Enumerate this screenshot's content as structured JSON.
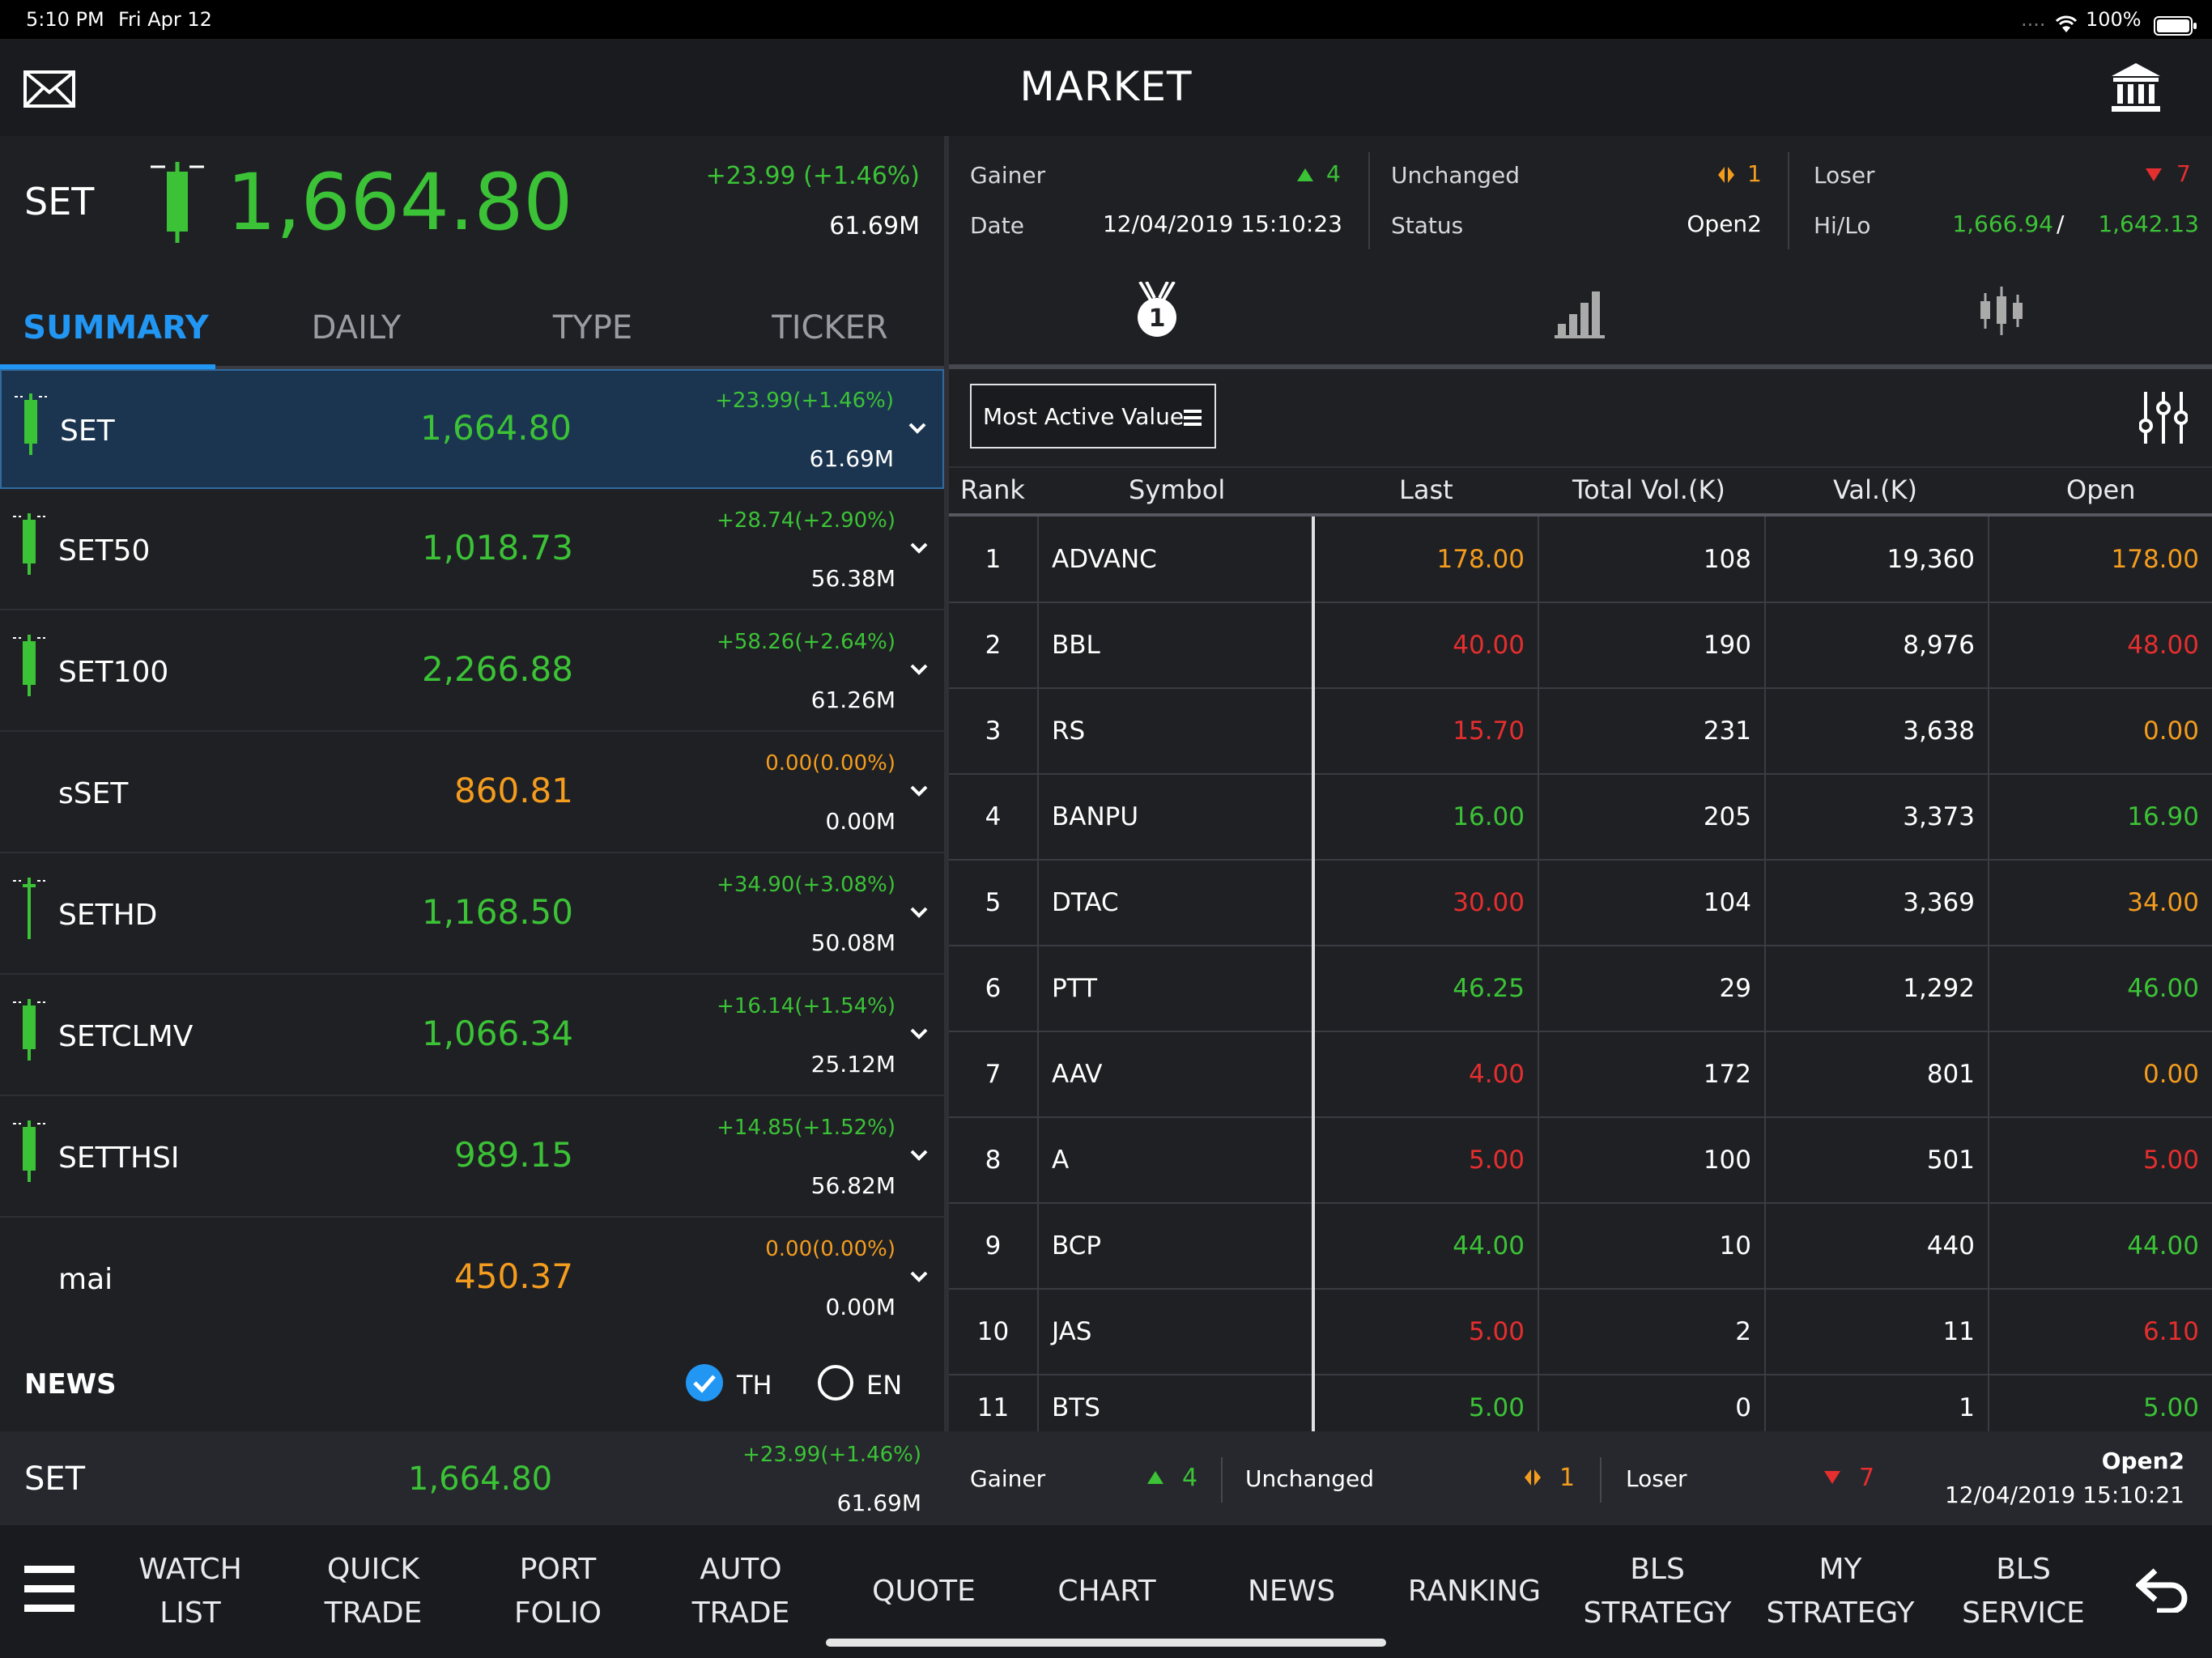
{
  "status_bar": {
    "time": "5:10 PM",
    "date": "Fri Apr 12",
    "battery": "100%",
    "signal_dots": "....",
    "wifi_icon": "wifi-icon",
    "battery_icon": "battery-icon"
  },
  "header": {
    "title": "MARKET",
    "mail_icon": "mail-icon",
    "bank_icon": "bank-icon"
  },
  "main_index": {
    "name": "SET",
    "value": "1,664.80",
    "change": "+23.99 (+1.46%)",
    "volume": "61.69M"
  },
  "market_stats": {
    "gainer_label": "Gainer",
    "gainer_value": "4",
    "unchanged_label": "Unchanged",
    "unchanged_value": "1",
    "loser_label": "Loser",
    "loser_value": "7",
    "date_label": "Date",
    "date_value": "12/04/2019 15:10:23",
    "status_label": "Status",
    "status_value": "Open2",
    "hilo_label": "Hi/Lo",
    "hi": "1,666.94",
    "lo": "1,642.13",
    "hilo_sep": "/"
  },
  "left_tabs": [
    "SUMMARY",
    "DAILY",
    "TYPE",
    "TICKER"
  ],
  "indices": [
    {
      "name": "SET",
      "value": "1,664.80",
      "change": "+23.99(+1.46%)",
      "volume": "61.69M",
      "color": "green"
    },
    {
      "name": "SET50",
      "value": "1,018.73",
      "change": "+28.74(+2.90%)",
      "volume": "56.38M",
      "color": "green"
    },
    {
      "name": "SET100",
      "value": "2,266.88",
      "change": "+58.26(+2.64%)",
      "volume": "61.26M",
      "color": "green"
    },
    {
      "name": "sSET",
      "value": "860.81",
      "change": "0.00(0.00%)",
      "volume": "0.00M",
      "color": "orange"
    },
    {
      "name": "SETHD",
      "value": "1,168.50",
      "change": "+34.90(+3.08%)",
      "volume": "50.08M",
      "color": "green"
    },
    {
      "name": "SETCLMV",
      "value": "1,066.34",
      "change": "+16.14(+1.54%)",
      "volume": "25.12M",
      "color": "green"
    },
    {
      "name": "SETTHSI",
      "value": "989.15",
      "change": "+14.85(+1.52%)",
      "volume": "56.82M",
      "color": "green"
    },
    {
      "name": "mai",
      "value": "450.37",
      "change": "0.00(0.00%)",
      "volume": "0.00M",
      "color": "orange"
    }
  ],
  "news": {
    "label": "NEWS",
    "th": "TH",
    "en": "EN",
    "selected": "TH"
  },
  "right_tabs": {
    "icons": [
      "medal-icon",
      "bar-chart-icon",
      "candlestick-icon"
    ],
    "medal_number": "1"
  },
  "ranking": {
    "selector_label": "Most Active Value",
    "columns": [
      "Rank",
      "Symbol",
      "Last",
      "Total Vol.(K)",
      "Val.(K)",
      "Open"
    ],
    "rows": [
      {
        "rank": "1",
        "symbol": "ADVANC",
        "last": "178.00",
        "last_color": "orange",
        "vol": "108",
        "val": "19,360",
        "open": "178.00",
        "open_color": "orange"
      },
      {
        "rank": "2",
        "symbol": "BBL",
        "last": "40.00",
        "last_color": "red",
        "vol": "190",
        "val": "8,976",
        "open": "48.00",
        "open_color": "red"
      },
      {
        "rank": "3",
        "symbol": "RS",
        "last": "15.70",
        "last_color": "red",
        "vol": "231",
        "val": "3,638",
        "open": "0.00",
        "open_color": "orange"
      },
      {
        "rank": "4",
        "symbol": "BANPU",
        "last": "16.00",
        "last_color": "green",
        "vol": "205",
        "val": "3,373",
        "open": "16.90",
        "open_color": "green"
      },
      {
        "rank": "5",
        "symbol": "DTAC",
        "last": "30.00",
        "last_color": "red",
        "vol": "104",
        "val": "3,369",
        "open": "34.00",
        "open_color": "orange"
      },
      {
        "rank": "6",
        "symbol": "PTT",
        "last": "46.25",
        "last_color": "green",
        "vol": "29",
        "val": "1,292",
        "open": "46.00",
        "open_color": "green"
      },
      {
        "rank": "7",
        "symbol": "AAV",
        "last": "4.00",
        "last_color": "red",
        "vol": "172",
        "val": "801",
        "open": "0.00",
        "open_color": "orange"
      },
      {
        "rank": "8",
        "symbol": "A",
        "last": "5.00",
        "last_color": "red",
        "vol": "100",
        "val": "501",
        "open": "5.00",
        "open_color": "red"
      },
      {
        "rank": "9",
        "symbol": "BCP",
        "last": "44.00",
        "last_color": "green",
        "vol": "10",
        "val": "440",
        "open": "44.00",
        "open_color": "green"
      },
      {
        "rank": "10",
        "symbol": "JAS",
        "last": "5.00",
        "last_color": "red",
        "vol": "2",
        "val": "11",
        "open": "6.10",
        "open_color": "red"
      },
      {
        "rank": "11",
        "symbol": "BTS",
        "last": "5.00",
        "last_color": "green",
        "vol": "0",
        "val": "1",
        "open": "5.00",
        "open_color": "green"
      }
    ]
  },
  "ticker": {
    "name": "SET",
    "value": "1,664.80",
    "change": "+23.99(+1.46%)",
    "volume": "61.69M",
    "gainer_label": "Gainer",
    "gainer_value": "4",
    "unchanged_label": "Unchanged",
    "unchanged_value": "1",
    "loser_label": "Loser",
    "loser_value": "7",
    "status": "Open2",
    "datetime": "12/04/2019 15:10:21"
  },
  "nav": [
    "WATCH\nLIST",
    "QUICK\nTRADE",
    "PORT\nFOLIO",
    "AUTO\nTRADE",
    "QUOTE",
    "CHART",
    "NEWS",
    "RANKING",
    "BLS\nSTRATEGY",
    "MY\nSTRATEGY",
    "BLS\nSERVICE"
  ],
  "colors": {
    "green": "#3bc236",
    "red": "#e52e2e",
    "orange": "#f39c1e",
    "accent": "#2196f3",
    "selected_row": "#1b3550"
  }
}
